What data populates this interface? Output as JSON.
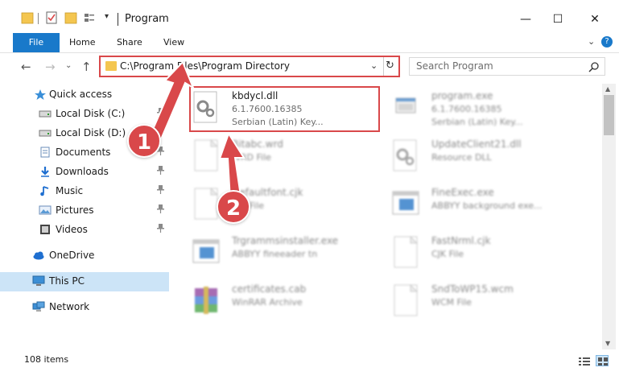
{
  "window": {
    "title": "Program",
    "minimize": "—",
    "maximize": "☐",
    "close": "✕"
  },
  "ribbon": {
    "tabs": [
      "File",
      "Home",
      "Share",
      "View"
    ],
    "collapse": "⌄",
    "help": "?"
  },
  "nav": {
    "back": "←",
    "forward": "→",
    "recent": "⌄",
    "up": "↑",
    "address": "C:\\Program Files\\Program Directory",
    "address_dropdown": "⌄",
    "refresh": "↻",
    "search_placeholder": "Search Program"
  },
  "sidebar": {
    "items": [
      {
        "label": "Quick access",
        "icon": "star-icon",
        "pinned": false
      },
      {
        "label": "Local Disk (C:)",
        "icon": "drive-icon",
        "pinned": true
      },
      {
        "label": "Local Disk (D:)",
        "icon": "drive-icon",
        "pinned": true
      },
      {
        "label": "Documents",
        "icon": "documents-icon",
        "pinned": true
      },
      {
        "label": "Downloads",
        "icon": "download-icon",
        "pinned": true
      },
      {
        "label": "Music",
        "icon": "music-icon",
        "pinned": true
      },
      {
        "label": "Pictures",
        "icon": "pictures-icon",
        "pinned": true
      },
      {
        "label": "Videos",
        "icon": "video-icon",
        "pinned": true
      },
      {
        "label": "OneDrive",
        "icon": "cloud-icon",
        "pinned": false
      },
      {
        "label": "This PC",
        "icon": "computer-icon",
        "pinned": false
      },
      {
        "label": "Network",
        "icon": "network-icon",
        "pinned": false
      }
    ],
    "pin_glyph": "📌"
  },
  "files": [
    {
      "name": "kbdycl.dll",
      "line2": "6.1.7600.16385",
      "line3": "Serbian (Latin) Key...",
      "icon": "dll-gear-icon"
    },
    {
      "name": "program.exe",
      "line2": "6.1.7600.16385",
      "line3": "Serbian (Latin) Key...",
      "icon": "exe-icon"
    },
    {
      "name": "Bitabc.wrd",
      "line2": "WRD File",
      "line3": "",
      "icon": "blank-file-icon"
    },
    {
      "name": "UpdateClient21.dll",
      "line2": "Resource DLL",
      "line3": "",
      "icon": "dll-gear-icon"
    },
    {
      "name": "Defaultfont.cjk",
      "line2": "CJK File",
      "line3": "",
      "icon": "blank-file-icon"
    },
    {
      "name": "FineExec.exe",
      "line2": "ABBYY background exe...",
      "line3": "",
      "icon": "window-app-icon"
    },
    {
      "name": "Trgrammsinstaller.exe",
      "line2": "ABBYY fineeader tn",
      "line3": "",
      "icon": "window-app-icon"
    },
    {
      "name": "FastNrml.cjk",
      "line2": "CJK File",
      "line3": "",
      "icon": "blank-file-icon"
    },
    {
      "name": "certificates.cab",
      "line2": "WinRAR Archive",
      "line3": "",
      "icon": "archive-icon"
    },
    {
      "name": "SndToWP15.wcm",
      "line2": "WCM File",
      "line3": "",
      "icon": "blank-file-icon"
    }
  ],
  "status": {
    "count": "108 items"
  },
  "annotations": {
    "step1": "1",
    "step2": "2"
  },
  "colors": {
    "accent": "#1979ca",
    "annotation_red": "#d9484a",
    "selection": "#cce4f7",
    "folder_yellow": "#f4c650"
  }
}
